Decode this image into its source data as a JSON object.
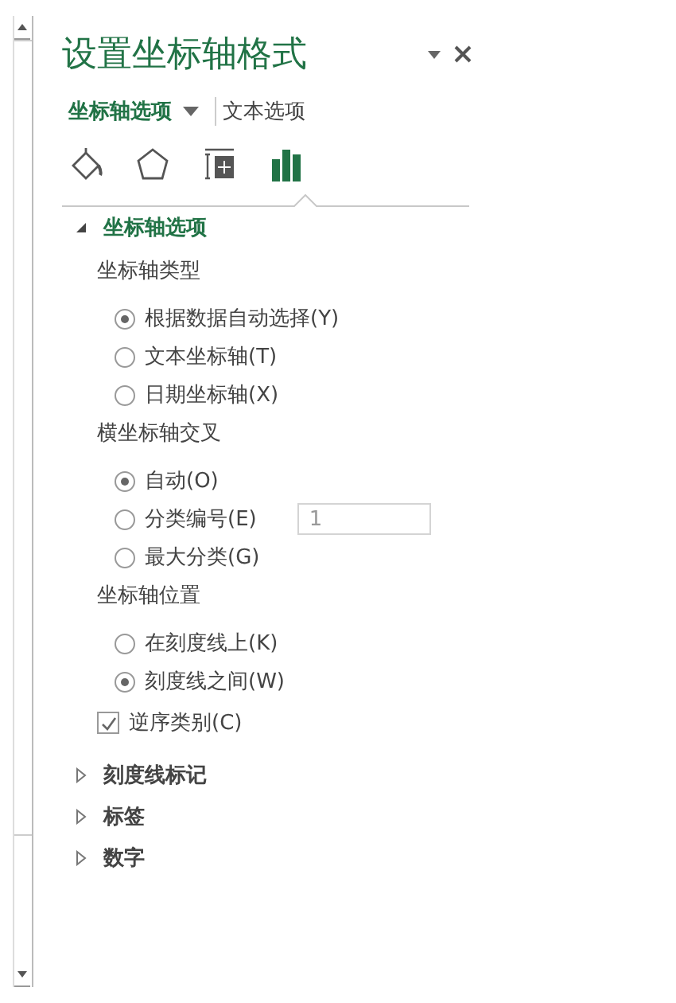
{
  "pane": {
    "title": "设置坐标轴格式"
  },
  "tabs": [
    {
      "label": "坐标轴选项",
      "selected": true,
      "has_menu": true
    },
    {
      "label": "文本选项",
      "selected": false,
      "has_menu": false
    }
  ],
  "icon_tabs": [
    {
      "kind": "fill",
      "selected": false
    },
    {
      "kind": "effects",
      "selected": false
    },
    {
      "kind": "size",
      "selected": false
    },
    {
      "kind": "options",
      "selected": true
    }
  ],
  "sections": [
    {
      "title": "坐标轴选项",
      "expanded": true,
      "items": [
        {
          "kind": "label",
          "text": "坐标轴类型"
        },
        {
          "kind": "radio",
          "text": "根据数据自动选择(Y)",
          "selected": true
        },
        {
          "kind": "radio",
          "text": "文本坐标轴(T)",
          "selected": false
        },
        {
          "kind": "radio",
          "text": "日期坐标轴(X)",
          "selected": false
        },
        {
          "kind": "label",
          "text": "横坐标轴交叉"
        },
        {
          "kind": "radio",
          "text": "自动(O)",
          "selected": true
        },
        {
          "kind": "radio",
          "text": "分类编号(E)",
          "selected": false,
          "field_value": "1"
        },
        {
          "kind": "radio",
          "text": "最大分类(G)",
          "selected": false
        },
        {
          "kind": "label",
          "text": "坐标轴位置"
        },
        {
          "kind": "radio",
          "text": "在刻度线上(K)",
          "selected": false
        },
        {
          "kind": "radio",
          "text": "刻度线之间(W)",
          "selected": true
        },
        {
          "kind": "checkbox",
          "text": "逆序类别(C)",
          "checked": true
        }
      ]
    },
    {
      "title": "刻度线标记",
      "expanded": false
    },
    {
      "title": "标签",
      "expanded": false
    },
    {
      "title": "数字",
      "expanded": false
    }
  ]
}
